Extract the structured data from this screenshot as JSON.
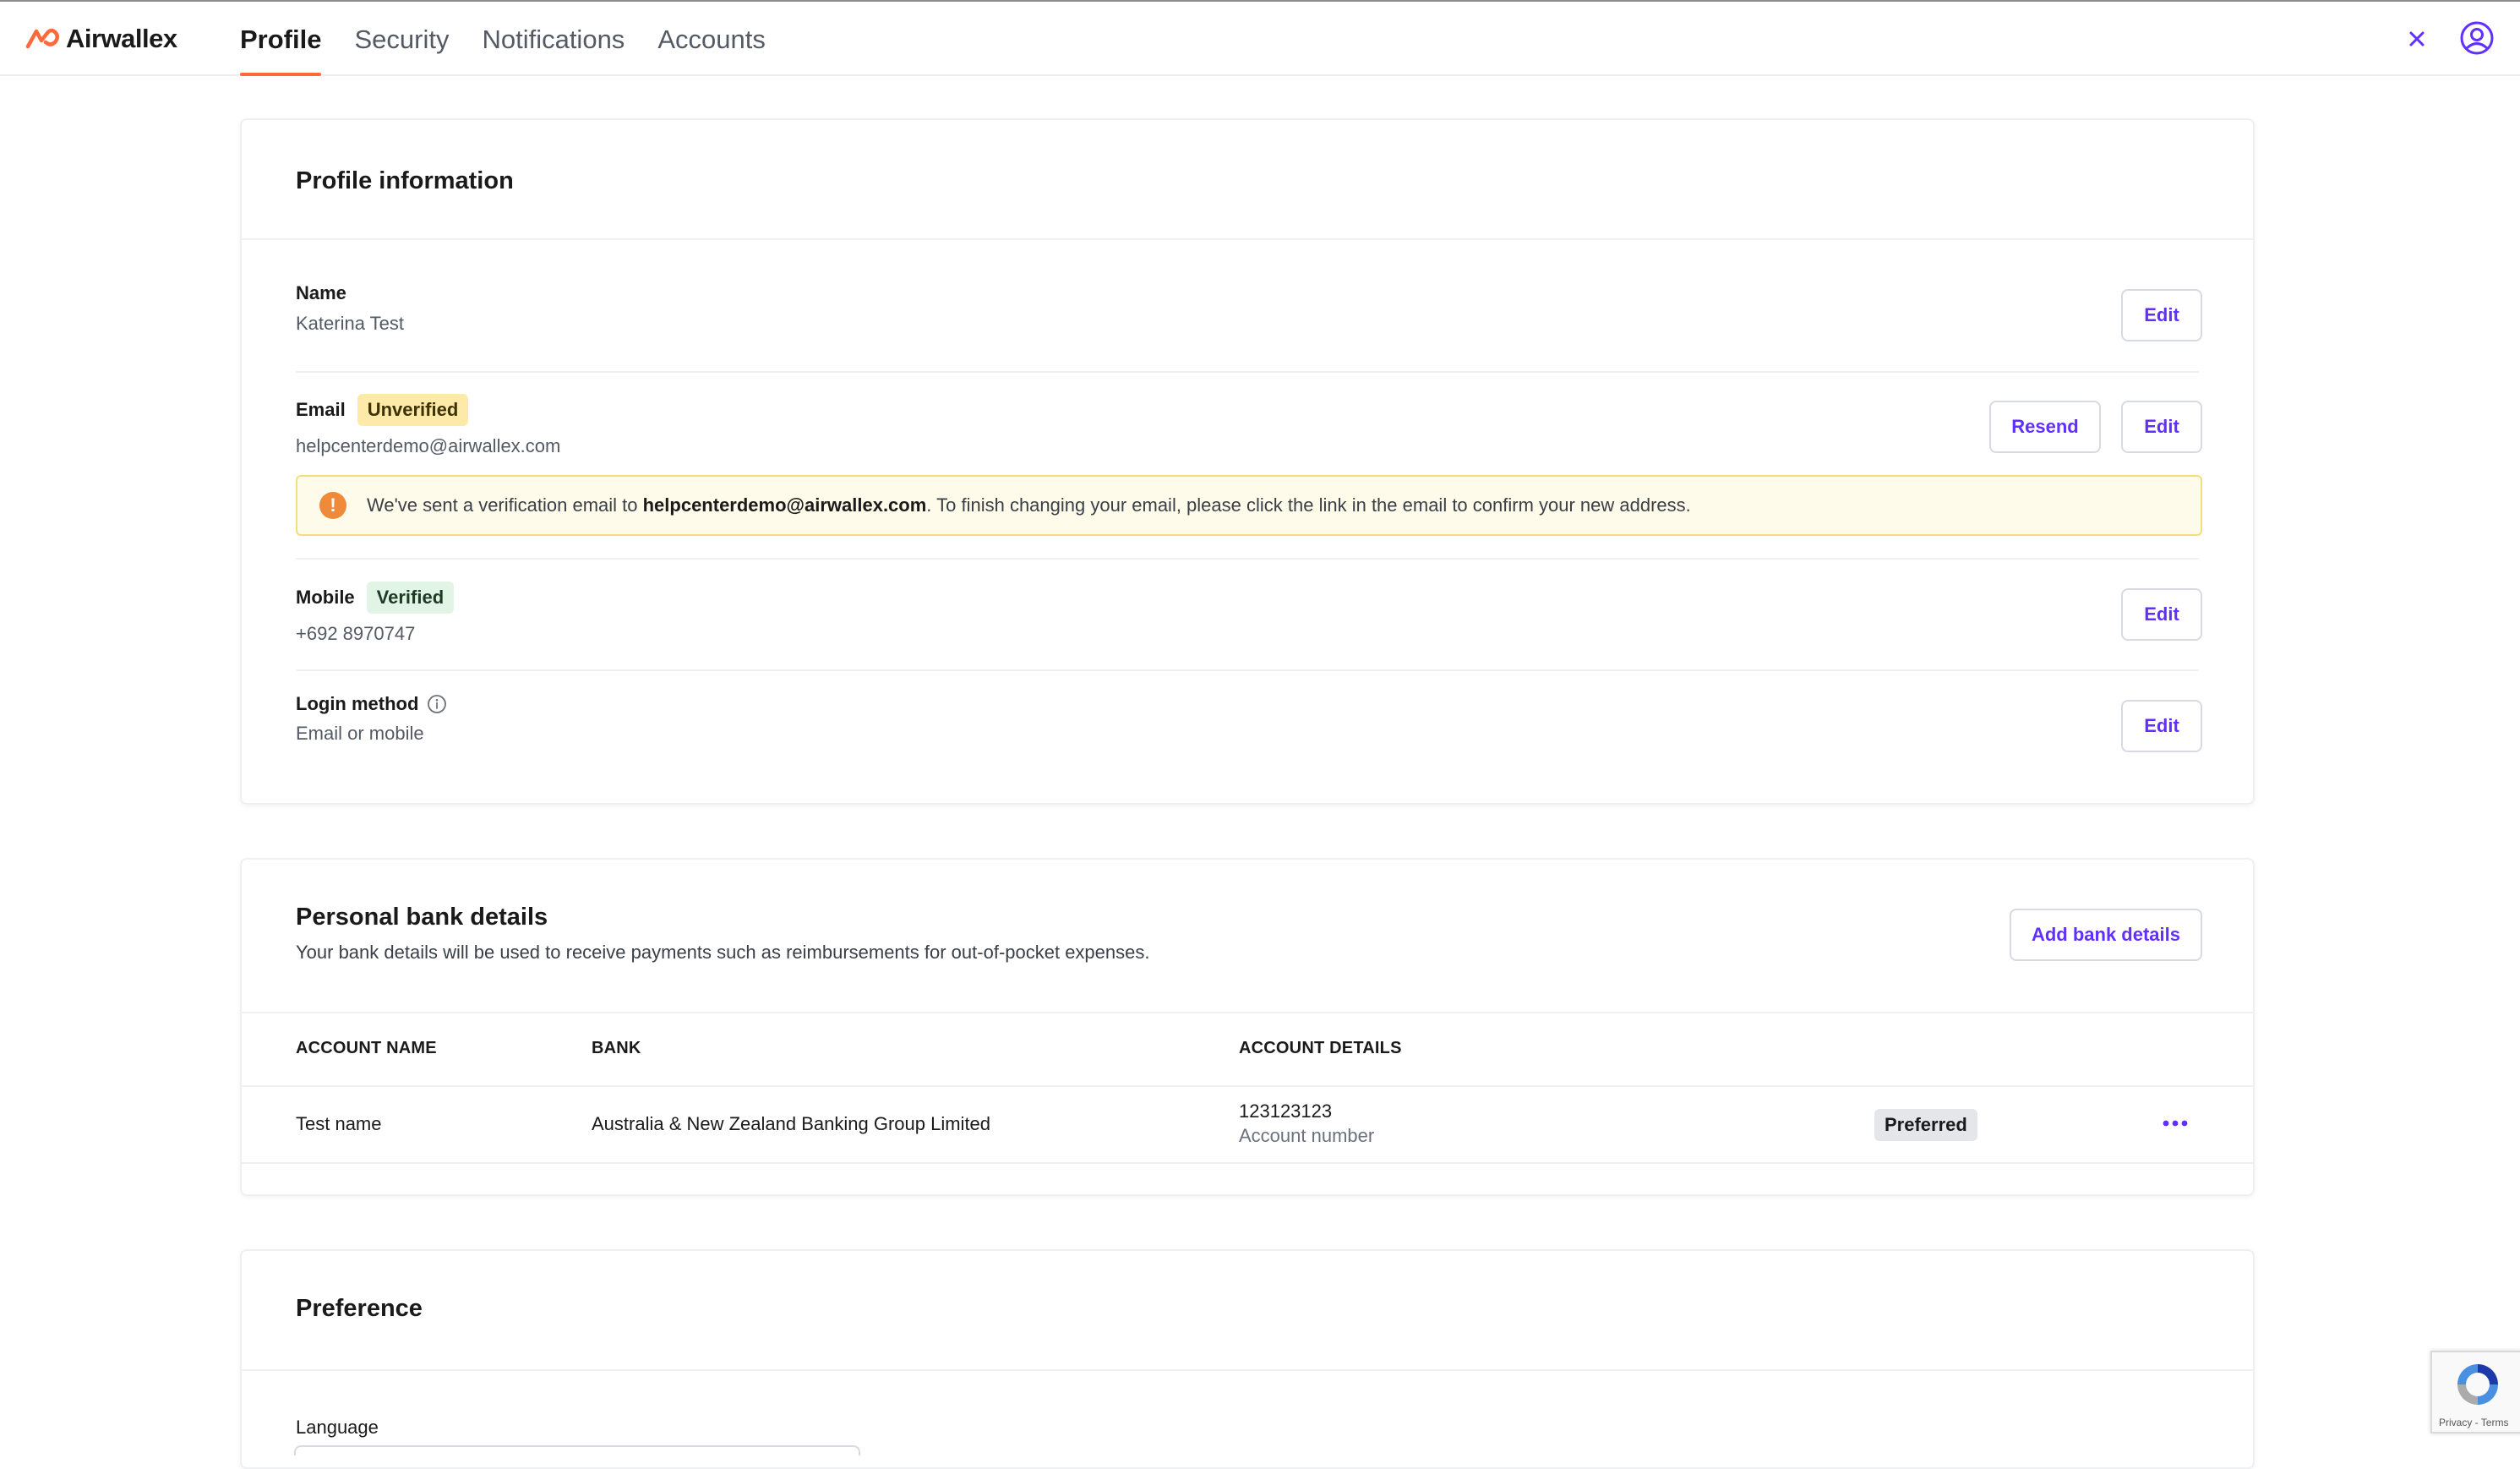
{
  "app": {
    "brand": "Airwallex",
    "brand_color": "#ff6a3d",
    "accent_color": "#612fff"
  },
  "nav": {
    "tabs": [
      {
        "label": "Profile",
        "active": true
      },
      {
        "label": "Security",
        "active": false
      },
      {
        "label": "Notifications",
        "active": false
      },
      {
        "label": "Accounts",
        "active": false
      }
    ]
  },
  "icons": {
    "close": "close-icon",
    "user": "user-circle-icon",
    "info": "info-icon",
    "warning": "warning-icon",
    "more": "more-horizontal-icon",
    "recaptcha": "recaptcha-icon"
  },
  "profile": {
    "title": "Profile information",
    "name": {
      "label": "Name",
      "value": "Katerina Test",
      "edit": "Edit"
    },
    "email": {
      "label": "Email",
      "badge": "Unverified",
      "value": "helpcenterdemo@airwallex.com",
      "resend": "Resend",
      "edit": "Edit",
      "notice_prefix": "We've sent a verification email to ",
      "notice_email": "helpcenterdemo@airwallex.com",
      "notice_suffix": ". To finish changing your email, please click the link in the email to confirm your new address.",
      "notice_icon": "!"
    },
    "mobile": {
      "label": "Mobile",
      "badge": "Verified",
      "value": "+692 8970747",
      "edit": "Edit"
    },
    "login": {
      "label": "Login method",
      "value": "Email or mobile",
      "edit": "Edit"
    }
  },
  "bank": {
    "title": "Personal bank details",
    "subtitle": "Your bank details will be used to receive payments such as reimbursements for out-of-pocket expenses.",
    "add_button": "Add bank details",
    "columns": [
      "ACCOUNT NAME",
      "BANK",
      "ACCOUNT DETAILS"
    ],
    "rows": [
      {
        "account_name": "Test name",
        "bank": "Australia & New Zealand Banking Group Limited",
        "account_number": "123123123",
        "account_number_label": "Account number",
        "status": "Preferred"
      }
    ]
  },
  "preference": {
    "title": "Preference",
    "language_label": "Language"
  },
  "recaptcha": {
    "links": "Privacy - Terms"
  }
}
